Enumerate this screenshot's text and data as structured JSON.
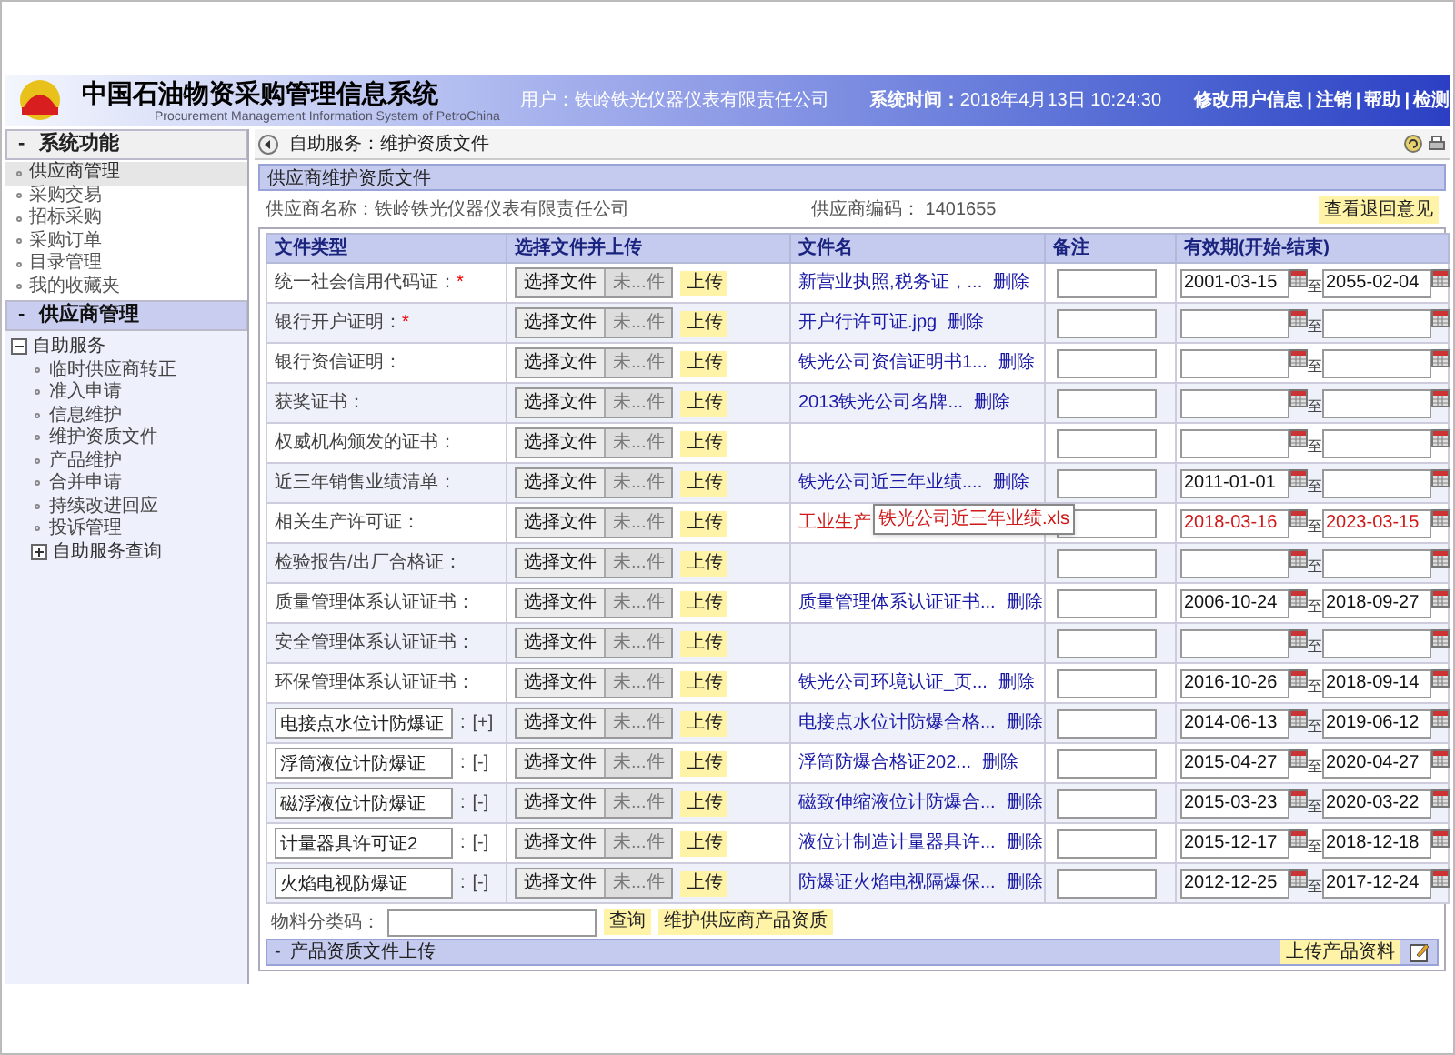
{
  "header": {
    "title": "中国石油物资采购管理信息系统",
    "subtitle": "Procurement Management Information System of PetroChina",
    "user": "用户：铁岭铁光仪器仪表有限责任公司",
    "time_label": "系统时间：",
    "time": "2018年4月13日 10:24:30",
    "links": [
      "修改用户信息",
      "注销",
      "帮助",
      "检测"
    ],
    "separator": "|"
  },
  "sidebar": {
    "sections": [
      {
        "title": "系统功能",
        "toggle": "-",
        "items": [
          {
            "label": "供应商管理",
            "selected": true
          },
          {
            "label": "采购交易",
            "selected": false
          },
          {
            "label": "招标采购",
            "selected": false
          },
          {
            "label": "采购订单",
            "selected": false
          },
          {
            "label": "目录管理",
            "selected": false
          },
          {
            "label": "我的收藏夹",
            "selected": false
          }
        ]
      },
      {
        "title": "供应商管理",
        "toggle": "-",
        "tree": [
          {
            "label": "自助服务",
            "expanded": true,
            "children": [
              {
                "label": "临时供应商转正",
                "selected": false
              },
              {
                "label": "准入申请",
                "selected": false
              },
              {
                "label": "信息维护",
                "selected": false
              },
              {
                "label": "维护资质文件",
                "selected": false
              },
              {
                "label": "产品维护",
                "selected": false
              },
              {
                "label": "合并申请",
                "selected": false
              },
              {
                "label": "持续改进回应",
                "selected": false
              },
              {
                "label": "投诉管理",
                "selected": false
              }
            ]
          },
          {
            "label": "自助服务查询",
            "expanded": false
          }
        ]
      }
    ]
  },
  "breadcrumb": "自助服务：维护资质文件",
  "panel": {
    "title": "供应商维护资质文件",
    "supplier_name_label": "供应商名称：",
    "supplier_name": "铁岭铁光仪器仪表有限责任公司",
    "supplier_code_label": "供应商编码：",
    "supplier_code": "1401655",
    "feedback_button": "查看退回意见"
  },
  "table": {
    "columns": [
      "文件类型",
      "选择文件并上传",
      "文件名",
      "备注",
      "有效期(开始-结束)"
    ],
    "rows": [
      {
        "kind": "fixed",
        "label": "统一社会信用代码证：",
        "required_mark": "*",
        "choose": "选择文件",
        "no_file": "未...件",
        "upload": "上传",
        "file": "新营业执照,税务证，...",
        "delete": "删除",
        "to": "至",
        "start": "2001-03-15",
        "end": "2055-02-04",
        "warning": false
      },
      {
        "kind": "fixed",
        "label": "银行开户证明：",
        "required_mark": "*",
        "choose": "选择文件",
        "no_file": "未...件",
        "upload": "上传",
        "file": "开户行许可证.jpg",
        "delete": "删除",
        "to": "至",
        "warning": false
      },
      {
        "kind": "fixed",
        "label": "银行资信证明：",
        "choose": "选择文件",
        "no_file": "未...件",
        "upload": "上传",
        "file": "铁光公司资信证明书1...",
        "delete": "删除",
        "to": "至",
        "warning": false
      },
      {
        "kind": "fixed",
        "label": "获奖证书：",
        "choose": "选择文件",
        "no_file": "未...件",
        "upload": "上传",
        "file": "2013铁光公司名牌...",
        "delete": "删除",
        "to": "至",
        "warning": false
      },
      {
        "kind": "fixed",
        "label": "权威机构颁发的证书：",
        "choose": "选择文件",
        "no_file": "未...件",
        "upload": "上传",
        "to": "至"
      },
      {
        "kind": "fixed",
        "label": "近三年销售业绩清单：",
        "choose": "选择文件",
        "no_file": "未...件",
        "upload": "上传",
        "file": "铁光公司近三年业绩....",
        "delete": "删除",
        "to": "至",
        "start": "2011-01-01",
        "warning": false
      },
      {
        "kind": "fixed",
        "label": "相关生产许可证：",
        "choose": "选择文件",
        "no_file": "未...件",
        "upload": "上传",
        "file": "工业生产",
        "tooltip": "铁光公司近三年业绩.xls",
        "to": "至",
        "start": "2018-03-16",
        "end": "2023-03-15",
        "warning": true
      },
      {
        "kind": "fixed",
        "label": "检验报告/出厂合格证：",
        "choose": "选择文件",
        "no_file": "未...件",
        "upload": "上传",
        "to": "至"
      },
      {
        "kind": "fixed",
        "label": "质量管理体系认证证书：",
        "choose": "选择文件",
        "no_file": "未...件",
        "upload": "上传",
        "file": "质量管理体系认证证书...",
        "delete": "删除",
        "to": "至",
        "start": "2006-10-24",
        "end": "2018-09-27",
        "warning": false
      },
      {
        "kind": "fixed",
        "label": "安全管理体系认证证书：",
        "choose": "选择文件",
        "no_file": "未...件",
        "upload": "上传",
        "to": "至"
      },
      {
        "kind": "fixed",
        "label": "环保管理体系认证证书：",
        "choose": "选择文件",
        "no_file": "未...件",
        "upload": "上传",
        "file": "铁光公司环境认证_页...",
        "delete": "删除",
        "to": "至",
        "start": "2016-10-26",
        "end": "2018-09-14",
        "warning": false
      },
      {
        "kind": "custom",
        "label": "电接点水位计防爆证",
        "colon": ":",
        "toggle": "[+]",
        "choose": "选择文件",
        "no_file": "未...件",
        "upload": "上传",
        "file": "电接点水位计防爆合格...",
        "delete": "删除",
        "to": "至",
        "start": "2014-06-13",
        "end": "2019-06-12",
        "warning": false
      },
      {
        "kind": "custom",
        "label": "浮筒液位计防爆证",
        "colon": ":",
        "toggle": "[-]",
        "choose": "选择文件",
        "no_file": "未...件",
        "upload": "上传",
        "file": "浮筒防爆合格证202...",
        "delete": "删除",
        "to": "至",
        "start": "2015-04-27",
        "end": "2020-04-27",
        "warning": false
      },
      {
        "kind": "custom",
        "label": "磁浮液位计防爆证",
        "colon": ":",
        "toggle": "[-]",
        "choose": "选择文件",
        "no_file": "未...件",
        "upload": "上传",
        "file": "磁致伸缩液位计防爆合...",
        "delete": "删除",
        "to": "至",
        "start": "2015-03-23",
        "end": "2020-03-22",
        "warning": false
      },
      {
        "kind": "custom",
        "label": "计量器具许可证2",
        "colon": ":",
        "toggle": "[-]",
        "choose": "选择文件",
        "no_file": "未...件",
        "upload": "上传",
        "file": "液位计制造计量器具许...",
        "delete": "删除",
        "to": "至",
        "start": "2015-12-17",
        "end": "2018-12-18",
        "warning": false
      },
      {
        "kind": "custom",
        "label": "火焰电视防爆证",
        "colon": ":",
        "toggle": "[-]",
        "choose": "选择文件",
        "no_file": "未...件",
        "upload": "上传",
        "file": "防爆证火焰电视隔爆保...",
        "delete": "删除",
        "to": "至",
        "start": "2012-12-25",
        "end": "2017-12-24",
        "warning": false
      }
    ]
  },
  "material": {
    "label": "物料分类码：",
    "search": "查询",
    "maintain": "维护供应商产品资质"
  },
  "product_bar": {
    "toggle": "-",
    "title": "产品资质文件上传",
    "upload": "上传产品资料"
  }
}
